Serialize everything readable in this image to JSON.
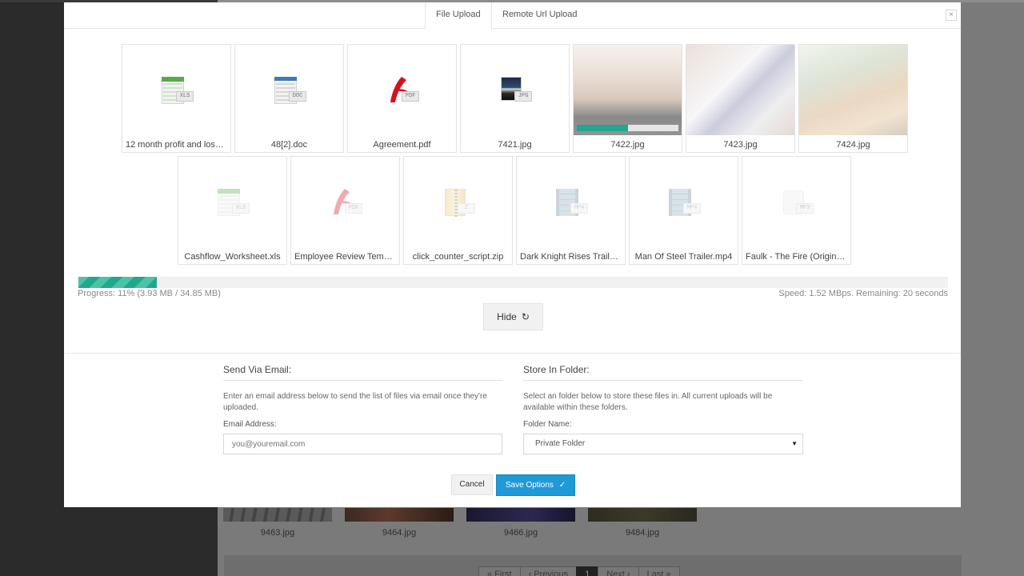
{
  "modal": {
    "tabs": [
      {
        "label": "File Upload",
        "active": true
      },
      {
        "label": "Remote Url Upload",
        "active": false
      }
    ],
    "close_glyph": "×",
    "files_row1": [
      {
        "name": "12 month profit and loss p...",
        "type": "xls",
        "badge": "XLS",
        "faded": false
      },
      {
        "name": "48[2].doc",
        "type": "doc",
        "badge": "DOC",
        "faded": false
      },
      {
        "name": "Agreement.pdf",
        "type": "pdf",
        "badge": "PDF",
        "faded": false
      },
      {
        "name": "7421.jpg",
        "type": "jpg",
        "badge": "JPG",
        "faded": false
      },
      {
        "name": "7422.jpg",
        "type": "photo",
        "badge": "",
        "faded": false,
        "upload_progress": 0.5
      },
      {
        "name": "7423.jpg",
        "type": "photo",
        "badge": "",
        "faded": true
      },
      {
        "name": "7424.jpg",
        "type": "photo",
        "badge": "",
        "faded": true
      }
    ],
    "files_row2": [
      {
        "name": "Cashflow_Worksheet.xls",
        "type": "xls",
        "badge": "XLS",
        "faded": true
      },
      {
        "name": "Employee Review Templat...",
        "type": "pdf",
        "badge": "PDF",
        "faded": true
      },
      {
        "name": "click_counter_script.zip",
        "type": "zip",
        "badge": "Z",
        "faded": true
      },
      {
        "name": "Dark Knight Rises Trailer....",
        "type": "mp4",
        "badge": "MP4",
        "faded": true
      },
      {
        "name": "Man Of Steel Trailer.mp4",
        "type": "mp4",
        "badge": "MP4",
        "faded": true
      },
      {
        "name": "Faulk - The Fire (Original ...",
        "type": "mp3",
        "badge": "MP3",
        "faded": true
      }
    ],
    "progress": {
      "fraction": 0.11,
      "left_text": "Progress: 11% (3.93 MB / 34.85 MB)",
      "right_text": "Speed: 1.52 MBps. Remaining: 20 seconds"
    },
    "hide_button": {
      "label": "Hide",
      "icon": "refresh-icon",
      "glyph": "↻"
    },
    "email": {
      "title": "Send Via Email:",
      "description": "Enter an email address below to send the list of files via email once they're uploaded.",
      "label": "Email Address:",
      "placeholder": "you@youremail.com"
    },
    "folder": {
      "title": "Store In Folder:",
      "description": "Select an folder below to store these files in. All current uploads will be available within these folders.",
      "label": "Folder Name:",
      "selected": "Private Folder",
      "caret": "▼"
    },
    "buttons": {
      "cancel": "Cancel",
      "save": "Save Options",
      "save_check": "✓"
    },
    "colors": {
      "accent_green": "#1fa88d",
      "save_blue": "#1f9ad6"
    }
  },
  "background": {
    "thumbs": [
      {
        "caption": "9463.jpg"
      },
      {
        "caption": "9464.jpg"
      },
      {
        "caption": "9466.jpg"
      },
      {
        "caption": "9484.jpg"
      }
    ],
    "pager": [
      "« First",
      "‹ Previous",
      "1",
      "Next ›",
      "Last »"
    ]
  }
}
